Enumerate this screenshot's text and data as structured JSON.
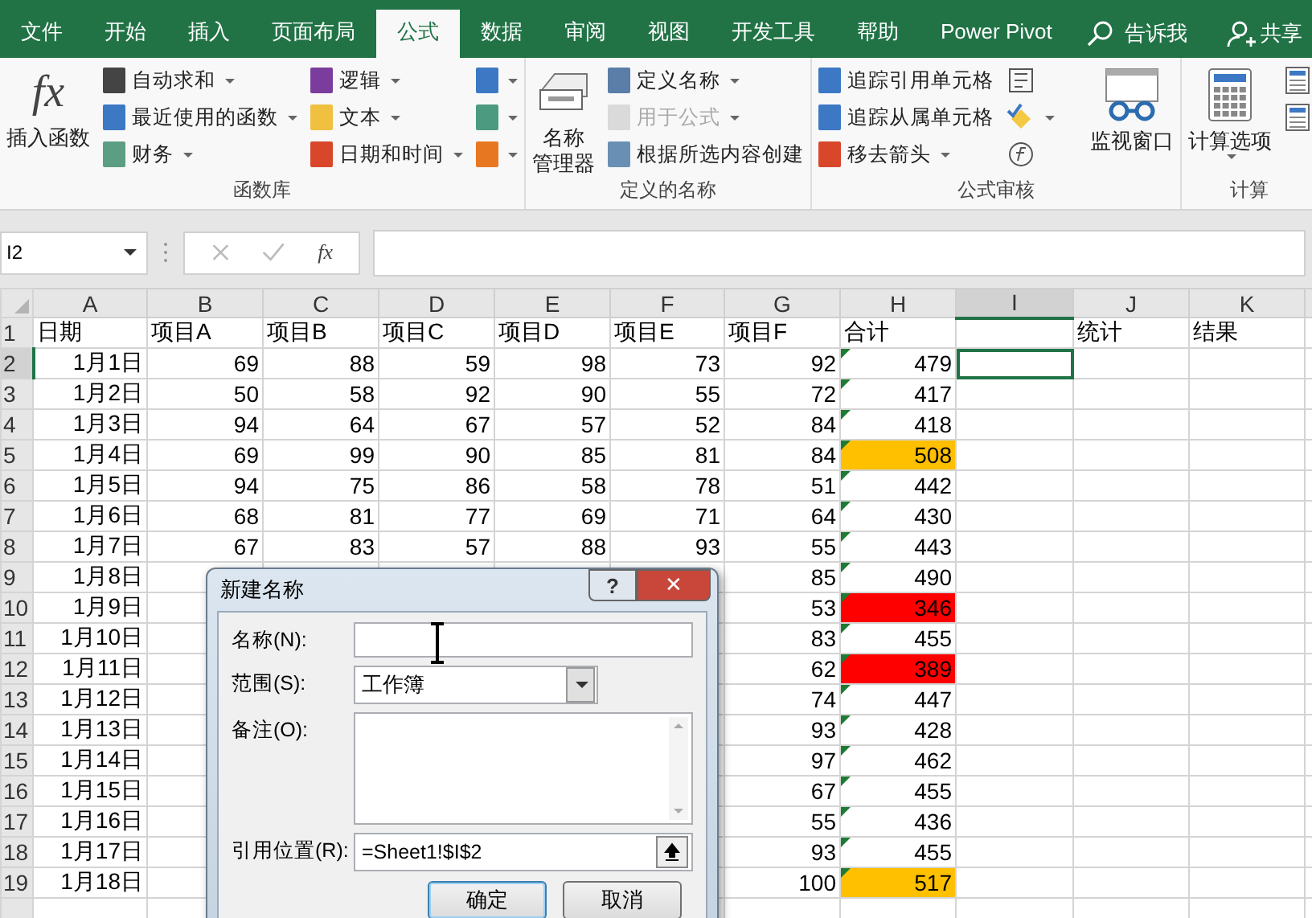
{
  "tabs": [
    {
      "label": "文件",
      "selected": false
    },
    {
      "label": "开始",
      "selected": false
    },
    {
      "label": "插入",
      "selected": false
    },
    {
      "label": "页面布局",
      "selected": false
    },
    {
      "label": "公式",
      "selected": true
    },
    {
      "label": "数据",
      "selected": false
    },
    {
      "label": "审阅",
      "selected": false
    },
    {
      "label": "视图",
      "selected": false
    },
    {
      "label": "开发工具",
      "selected": false
    },
    {
      "label": "帮助",
      "selected": false
    },
    {
      "label": "Power Pivot",
      "selected": false
    }
  ],
  "tell_me": "告诉我",
  "share": "共享",
  "ribbon": {
    "groups": [
      {
        "label": "函数库",
        "large": {
          "icon_text": "fx",
          "label": "插入函数"
        },
        "columns": [
          [
            {
              "label": "自动求和",
              "dropdown": true,
              "disabled": false
            },
            {
              "label": "最近使用的函数",
              "dropdown": true,
              "disabled": false
            },
            {
              "label": "财务",
              "dropdown": true,
              "disabled": false
            }
          ],
          [
            {
              "label": "逻辑",
              "dropdown": true,
              "disabled": false
            },
            {
              "label": "文本",
              "dropdown": true,
              "disabled": false
            },
            {
              "label": "日期和时间",
              "dropdown": true,
              "disabled": false
            }
          ]
        ],
        "icon_buttons": [
          {
            "dropdown": true
          },
          {
            "dropdown": true
          },
          {
            "dropdown": true
          }
        ]
      },
      {
        "label": "定义的名称",
        "large": {
          "label_lines": [
            "名称",
            "管理器"
          ]
        },
        "columns": [
          [
            {
              "label": "定义名称",
              "dropdown": true,
              "disabled": false
            },
            {
              "label": "用于公式",
              "dropdown": true,
              "disabled": true
            },
            {
              "label": "根据所选内容创建",
              "dropdown": false,
              "disabled": false
            }
          ]
        ]
      },
      {
        "label": "公式审核",
        "columns": [
          [
            {
              "label": "追踪引用单元格",
              "dropdown": false,
              "disabled": false
            },
            {
              "label": "追踪从属单元格",
              "dropdown": false,
              "disabled": false
            },
            {
              "label": "移去箭头",
              "dropdown": true,
              "disabled": false
            }
          ]
        ],
        "icon_buttons": [
          {
            "dropdown": false
          },
          {
            "dropdown": true
          },
          {
            "dropdown": false
          }
        ],
        "large_after": {
          "label": "监视窗口"
        }
      },
      {
        "label": "计算",
        "large": {
          "label": "计算选项",
          "dropdown": true
        },
        "icon_buttons": [
          {
            "dropdown": false
          },
          {
            "dropdown": false
          }
        ]
      }
    ]
  },
  "formula_bar": {
    "name_box": "I2",
    "fx": "fx"
  },
  "columns": [
    {
      "label": "A",
      "selected": false
    },
    {
      "label": "B",
      "selected": false
    },
    {
      "label": "C",
      "selected": false
    },
    {
      "label": "D",
      "selected": false
    },
    {
      "label": "E",
      "selected": false
    },
    {
      "label": "F",
      "selected": false
    },
    {
      "label": "G",
      "selected": false
    },
    {
      "label": "H",
      "selected": false
    },
    {
      "label": "I",
      "selected": true
    },
    {
      "label": "J",
      "selected": false
    },
    {
      "label": "K",
      "selected": false
    }
  ],
  "rows": [
    {
      "number": "1",
      "selected": false,
      "cells": [
        "日期",
        "项目A",
        "项目B",
        "项目C",
        "项目D",
        "项目E",
        "项目F",
        "合计",
        "",
        "统计",
        "结果"
      ]
    },
    {
      "number": "2",
      "selected": true,
      "cells": [
        "1月1日",
        "69",
        "88",
        "59",
        "98",
        "73",
        "92",
        "479",
        "",
        "",
        ""
      ],
      "flagged": true
    },
    {
      "number": "3",
      "selected": false,
      "cells": [
        "1月2日",
        "50",
        "58",
        "92",
        "90",
        "55",
        "72",
        "417",
        "",
        "",
        ""
      ],
      "flagged": true
    },
    {
      "number": "4",
      "selected": false,
      "cells": [
        "1月3日",
        "94",
        "64",
        "67",
        "57",
        "52",
        "84",
        "418",
        "",
        "",
        ""
      ],
      "flagged": true
    },
    {
      "number": "5",
      "selected": false,
      "cells": [
        "1月4日",
        "69",
        "99",
        "90",
        "85",
        "81",
        "84",
        "508",
        "",
        "",
        ""
      ],
      "flagged": true,
      "color": "#ffc000"
    },
    {
      "number": "6",
      "selected": false,
      "cells": [
        "1月5日",
        "94",
        "75",
        "86",
        "58",
        "78",
        "51",
        "442",
        "",
        "",
        ""
      ],
      "flagged": true
    },
    {
      "number": "7",
      "selected": false,
      "cells": [
        "1月6日",
        "68",
        "81",
        "77",
        "69",
        "71",
        "64",
        "430",
        "",
        "",
        ""
      ],
      "flagged": true
    },
    {
      "number": "8",
      "selected": false,
      "cells": [
        "1月7日",
        "67",
        "83",
        "57",
        "88",
        "93",
        "55",
        "443",
        "",
        "",
        ""
      ],
      "flagged": true
    },
    {
      "number": "9",
      "selected": false,
      "cells": [
        "1月8日",
        null,
        null,
        null,
        null,
        null,
        "85",
        "490",
        "",
        "",
        ""
      ],
      "flagged": true
    },
    {
      "number": "10",
      "selected": false,
      "cells": [
        "1月9日",
        null,
        null,
        null,
        null,
        null,
        "53",
        "346",
        "",
        "",
        ""
      ],
      "flagged": true,
      "color": "#ff0000"
    },
    {
      "number": "11",
      "selected": false,
      "cells": [
        "1月10日",
        null,
        null,
        null,
        null,
        null,
        "83",
        "455",
        "",
        "",
        ""
      ],
      "flagged": true
    },
    {
      "number": "12",
      "selected": false,
      "cells": [
        "1月11日",
        null,
        null,
        null,
        null,
        null,
        "62",
        "389",
        "",
        "",
        ""
      ],
      "flagged": true,
      "color": "#ff0000"
    },
    {
      "number": "13",
      "selected": false,
      "cells": [
        "1月12日",
        null,
        null,
        null,
        null,
        null,
        "74",
        "447",
        "",
        "",
        ""
      ],
      "flagged": true
    },
    {
      "number": "14",
      "selected": false,
      "cells": [
        "1月13日",
        null,
        null,
        null,
        null,
        null,
        "93",
        "428",
        "",
        "",
        ""
      ],
      "flagged": true
    },
    {
      "number": "15",
      "selected": false,
      "cells": [
        "1月14日",
        null,
        null,
        null,
        null,
        null,
        "97",
        "462",
        "",
        "",
        ""
      ],
      "flagged": true
    },
    {
      "number": "16",
      "selected": false,
      "cells": [
        "1月15日",
        null,
        null,
        null,
        null,
        null,
        "67",
        "455",
        "",
        "",
        ""
      ],
      "flagged": true
    },
    {
      "number": "17",
      "selected": false,
      "cells": [
        "1月16日",
        null,
        null,
        null,
        null,
        null,
        "55",
        "436",
        "",
        "",
        ""
      ],
      "flagged": true
    },
    {
      "number": "18",
      "selected": false,
      "cells": [
        "1月17日",
        null,
        null,
        null,
        null,
        null,
        "93",
        "455",
        "",
        "",
        ""
      ],
      "flagged": true
    },
    {
      "number": "19",
      "selected": false,
      "cells": [
        "1月18日",
        null,
        null,
        null,
        null,
        null,
        "100",
        "517",
        "",
        "",
        ""
      ],
      "flagged": true,
      "color": "#ffc000"
    }
  ],
  "dialog": {
    "title": "新建名称",
    "help": "?",
    "close": "✕",
    "name_label": "名称(N):",
    "scope_label": "范围(S):",
    "scope_value": "工作簿",
    "comment_label": "备注(O):",
    "ref_label": "引用位置(R):",
    "ref_value": "=Sheet1!$I$2",
    "ok": "确定",
    "cancel": "取消"
  }
}
